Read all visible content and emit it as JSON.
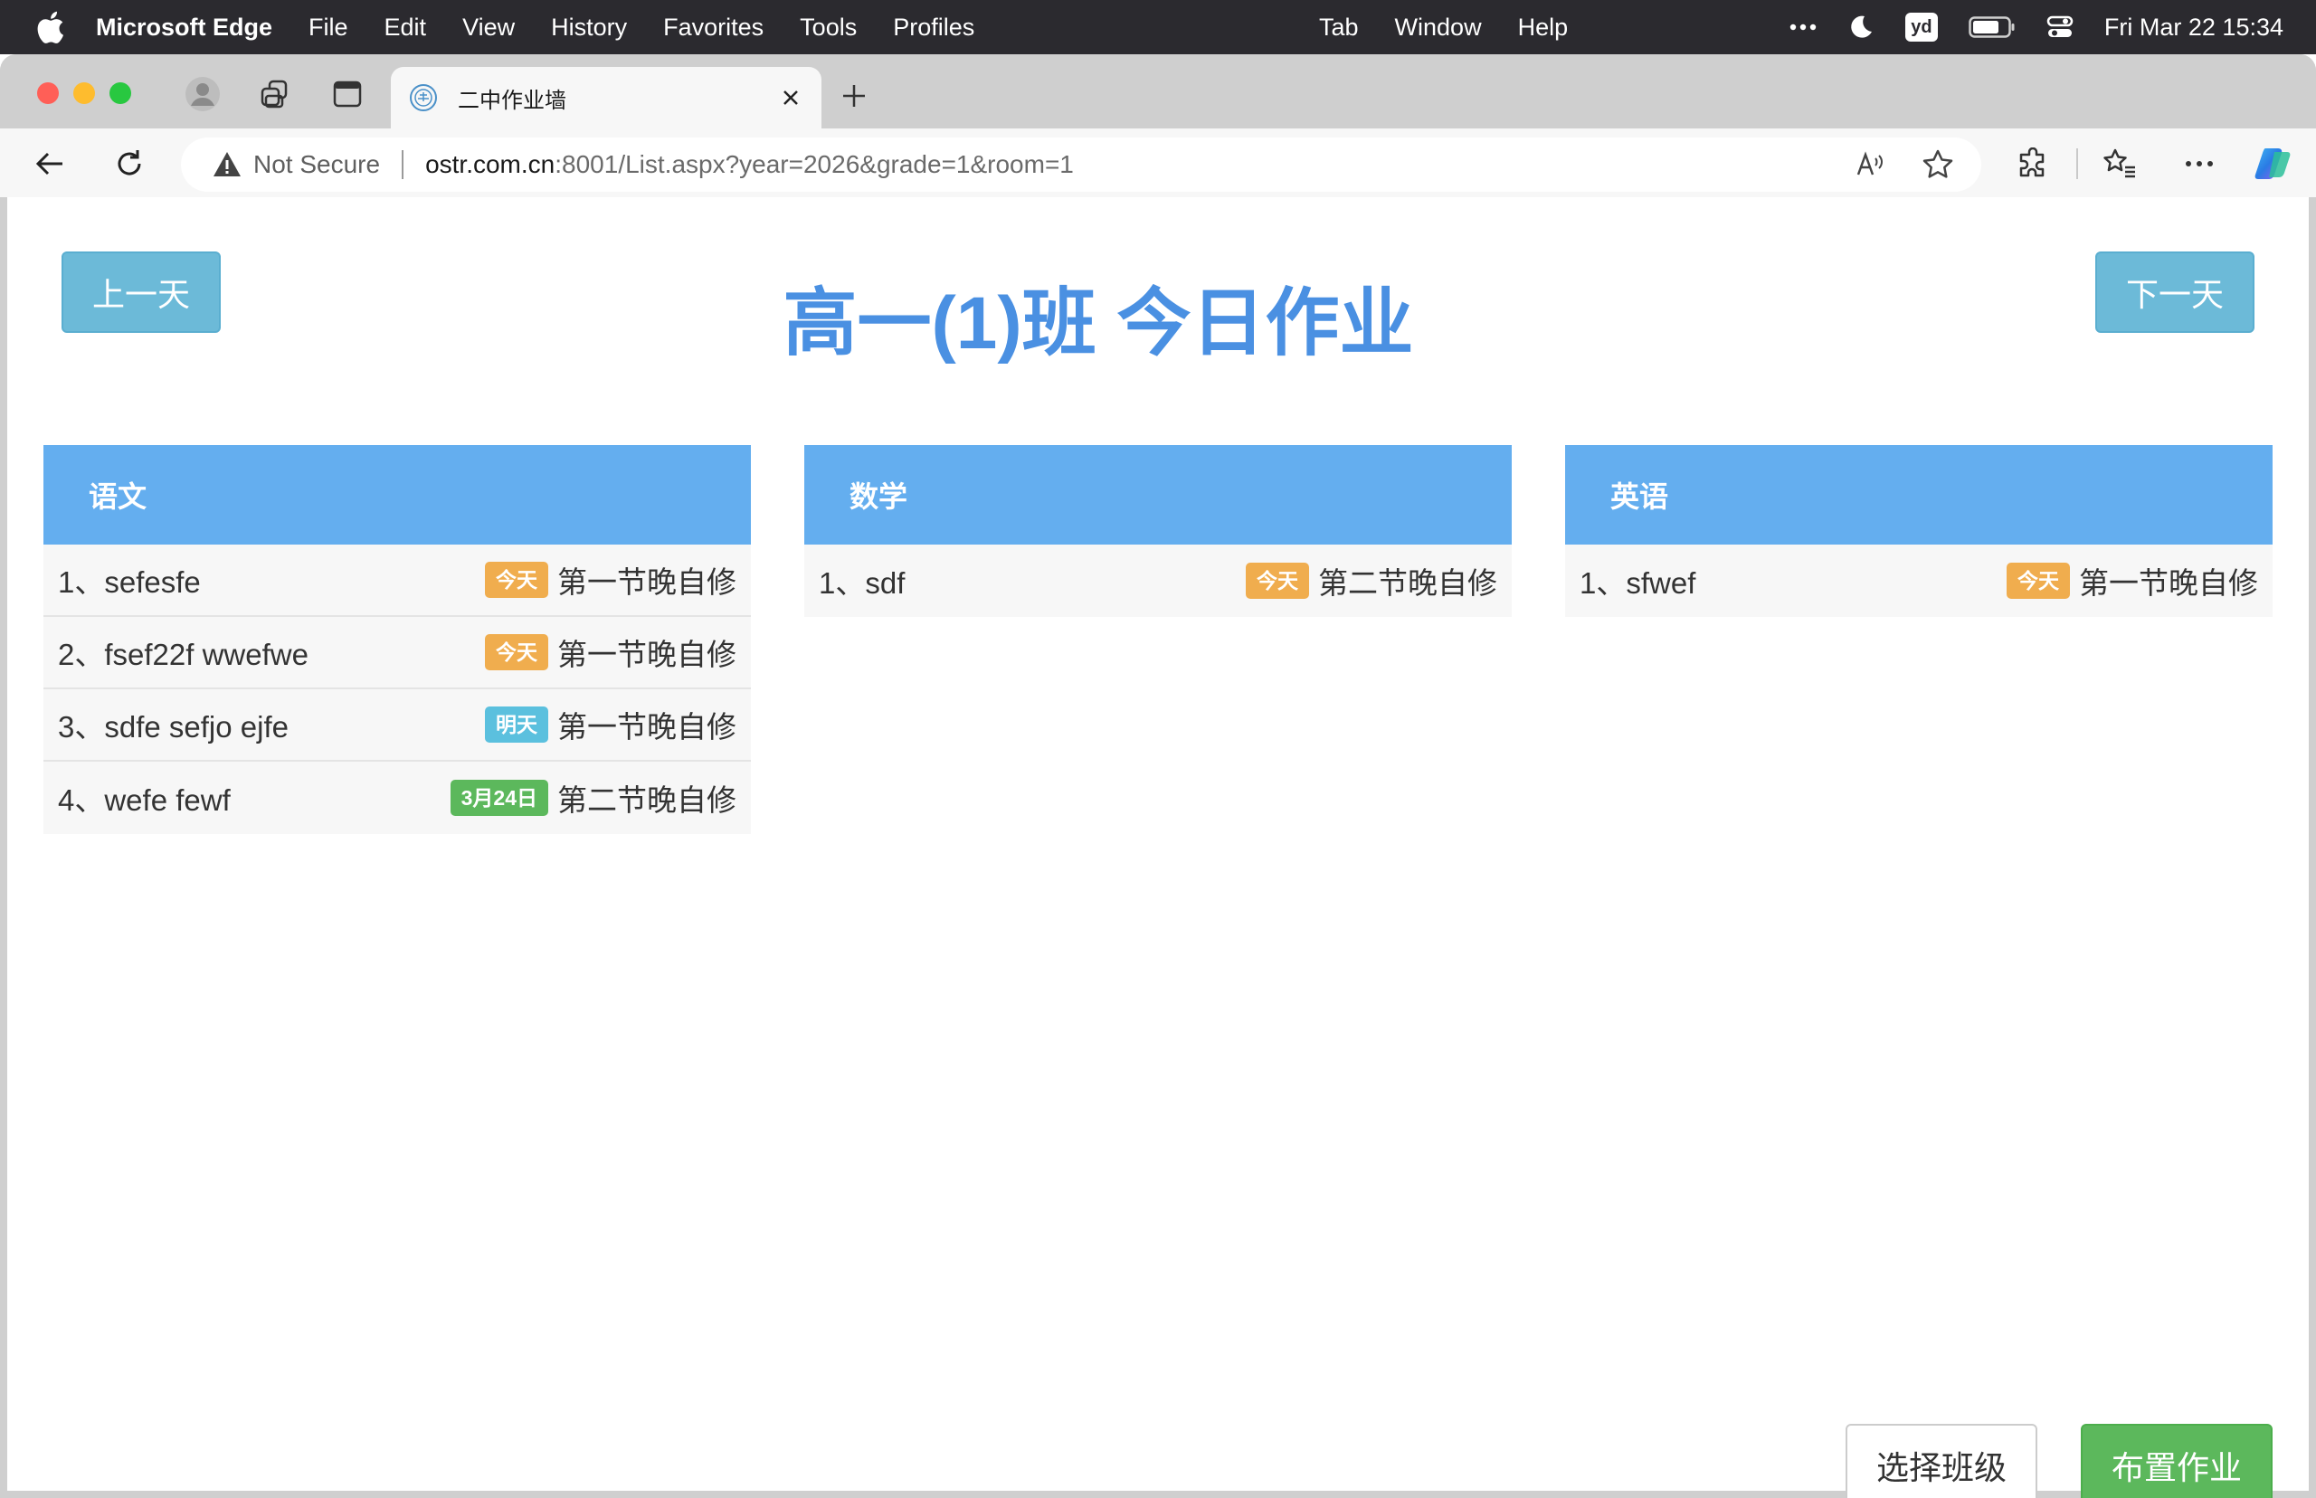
{
  "menubar": {
    "app_name": "Microsoft Edge",
    "items": [
      "File",
      "Edit",
      "View",
      "History",
      "Favorites",
      "Tools",
      "Profiles"
    ],
    "center_items": [
      "Tab",
      "Window",
      "Help"
    ],
    "datetime": "Fri Mar 22  15:34",
    "yd_label": "yd"
  },
  "browser": {
    "tab_title": "二中作业墙",
    "not_secure_label": "Not Secure",
    "url_host": "ostr.com.cn",
    "url_path": ":8001/List.aspx?year=2026&grade=1&room=1"
  },
  "page": {
    "title": "高一(1)班 今日作业",
    "prev_label": "上一天",
    "next_label": "下一天",
    "select_class_label": "选择班级",
    "assign_label": "布置作业",
    "subjects": [
      {
        "name": "语文",
        "rows": [
          {
            "text": "1、sefesfe",
            "badge": "今天",
            "badge_color": "#f0ad4e",
            "period": "第一节晚自修"
          },
          {
            "text": "2、fsef22f wwefwe",
            "badge": "今天",
            "badge_color": "#f0ad4e",
            "period": "第一节晚自修"
          },
          {
            "text": "3、sdfe sefjo ejfe",
            "badge": "明天",
            "badge_color": "#5bc0de",
            "period": "第一节晚自修"
          },
          {
            "text": "4、wefe fewf",
            "badge": "3月24日",
            "badge_color": "#5cb85c",
            "period": "第二节晚自修"
          }
        ]
      },
      {
        "name": "数学",
        "rows": [
          {
            "text": "1、sdf",
            "badge": "今天",
            "badge_color": "#f0ad4e",
            "period": "第二节晚自修"
          }
        ]
      },
      {
        "name": "英语",
        "rows": [
          {
            "text": "1、sfwef",
            "badge": "今天",
            "badge_color": "#f0ad4e",
            "period": "第一节晚自修"
          }
        ]
      }
    ]
  },
  "colors": {
    "title_blue": "#4a90e2",
    "card_header": "#64aeef",
    "day_button": "#6cbad8",
    "assign_button": "#5cb85c"
  }
}
